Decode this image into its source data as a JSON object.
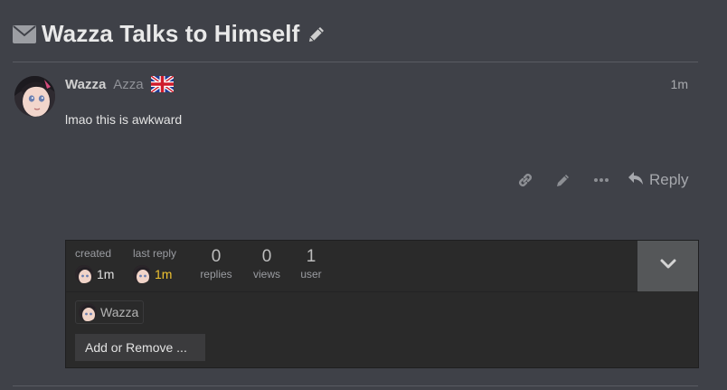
{
  "topic": {
    "title": "Wazza Talks to Himself"
  },
  "post": {
    "username": "Wazza",
    "full_name": "Azza",
    "time": "1m",
    "body": "lmao this is awkward",
    "reply_label": "Reply",
    "icons": [
      "link-icon",
      "pencil-icon",
      "ellipsis-icon",
      "reply-arrow-icon"
    ]
  },
  "summary": {
    "created_label": "created",
    "created_time": "1m",
    "last_reply_label": "last reply",
    "last_reply_time": "1m",
    "replies_count": "0",
    "replies_label": "replies",
    "views_count": "0",
    "views_label": "views",
    "users_count": "1",
    "users_label": "user",
    "participant_name": "Wazza",
    "add_remove_label": "Add or Remove ..."
  },
  "colors": {
    "background": "#3f4148",
    "summary_background": "#2a2a2a",
    "last_reply_highlight": "#f0c330",
    "expand_button": "#555759"
  }
}
